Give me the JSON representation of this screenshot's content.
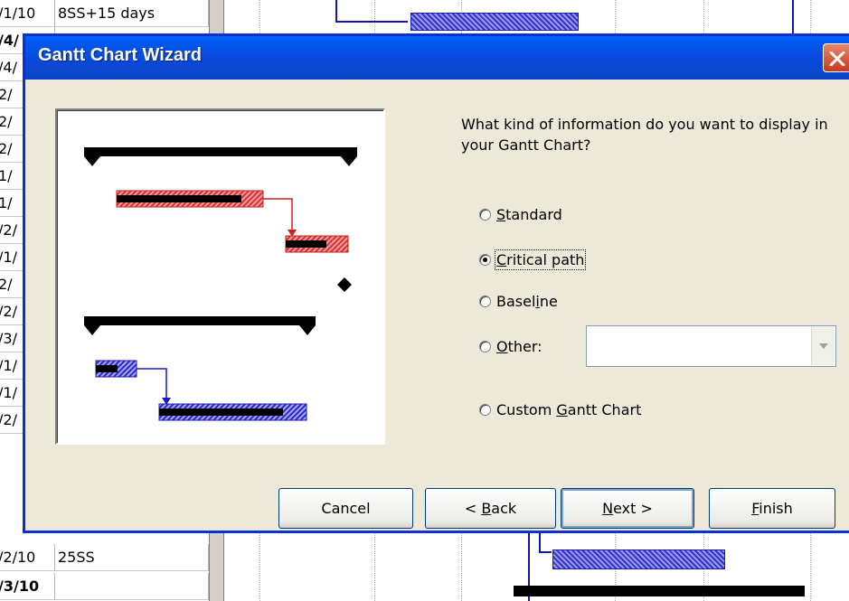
{
  "background_sheet": {
    "col_a": [
      "/1/10",
      "/4/",
      "/4/",
      "2/",
      "2/",
      "2/",
      "1/",
      "1/",
      "/2/",
      "/1/",
      "2/",
      "/2/",
      "/3/",
      "/1/",
      "/1/",
      "/2/",
      "/2/10",
      "/3/10"
    ],
    "col_b": [
      "8SS+15 days",
      "",
      "",
      "",
      "",
      "",
      "",
      "",
      "",
      "",
      "",
      "",
      "",
      "",
      "",
      "",
      "25SS",
      ""
    ],
    "bold_rows": [
      1,
      17
    ]
  },
  "dialog": {
    "title": "Gantt Chart Wizard",
    "question": "What kind of information do you want to display in your Gantt Chart?",
    "options": [
      {
        "pre": "",
        "ul": "S",
        "post": "tandard",
        "checked": false
      },
      {
        "pre": "",
        "ul": "C",
        "post": "ritical path",
        "checked": true
      },
      {
        "pre": "Basel",
        "ul": "i",
        "post": "ne",
        "checked": false
      },
      {
        "pre": "",
        "ul": "O",
        "post": "ther:",
        "checked": false
      },
      {
        "pre": "Custom ",
        "ul": "G",
        "post": "antt Chart",
        "checked": false
      }
    ],
    "other_value": "",
    "buttons": {
      "cancel": {
        "pre": "Cancel",
        "ul": "",
        "post": ""
      },
      "back": {
        "pre": "< ",
        "ul": "B",
        "post": "ack"
      },
      "next": {
        "pre": "",
        "ul": "N",
        "post": "ext >"
      },
      "finish": {
        "pre": "",
        "ul": "F",
        "post": "inish"
      }
    }
  },
  "colors": {
    "title_bar": "#0a49db",
    "dialog_bg": "#ece9d8",
    "critical_bar": "#e02020",
    "normal_bar": "#2a2ad8"
  }
}
